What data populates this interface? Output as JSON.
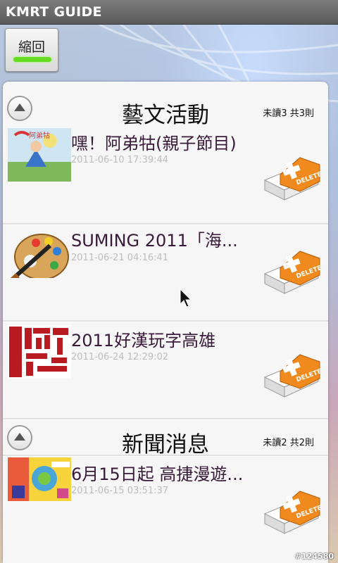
{
  "app": {
    "title": "KMRT GUIDE"
  },
  "collapse_button": {
    "label": "縮回"
  },
  "sections": [
    {
      "title": "藝文活動",
      "count": "未讀3 共3則",
      "items": [
        {
          "title": "嘿！阿弟牯(親子節目)",
          "time": "2011-06-10 17:39:44",
          "thumb": "children-illustration"
        },
        {
          "title": "SUMING 2011「海...",
          "time": "2011-06-21 04:16:41",
          "thumb": "paint-palette-icon"
        },
        {
          "title": "2011好漢玩字高雄",
          "time": "2011-06-24 12:29:02",
          "thumb": "red-maze-logo"
        }
      ]
    },
    {
      "title": "新聞消息",
      "count": "未讀2 共2則",
      "items": [
        {
          "title": "6月15日起 高捷漫遊...",
          "time": "2011-06-15 03:51:37",
          "thumb": "comic-poster"
        }
      ]
    }
  ],
  "delete_label": "DELETE",
  "watermark": "#124580",
  "colors": {
    "accent_green": "#66dd22",
    "delete_orange": "#f08a1e",
    "title_text": "#3a1a3a",
    "time_text": "#bdbdbd"
  }
}
